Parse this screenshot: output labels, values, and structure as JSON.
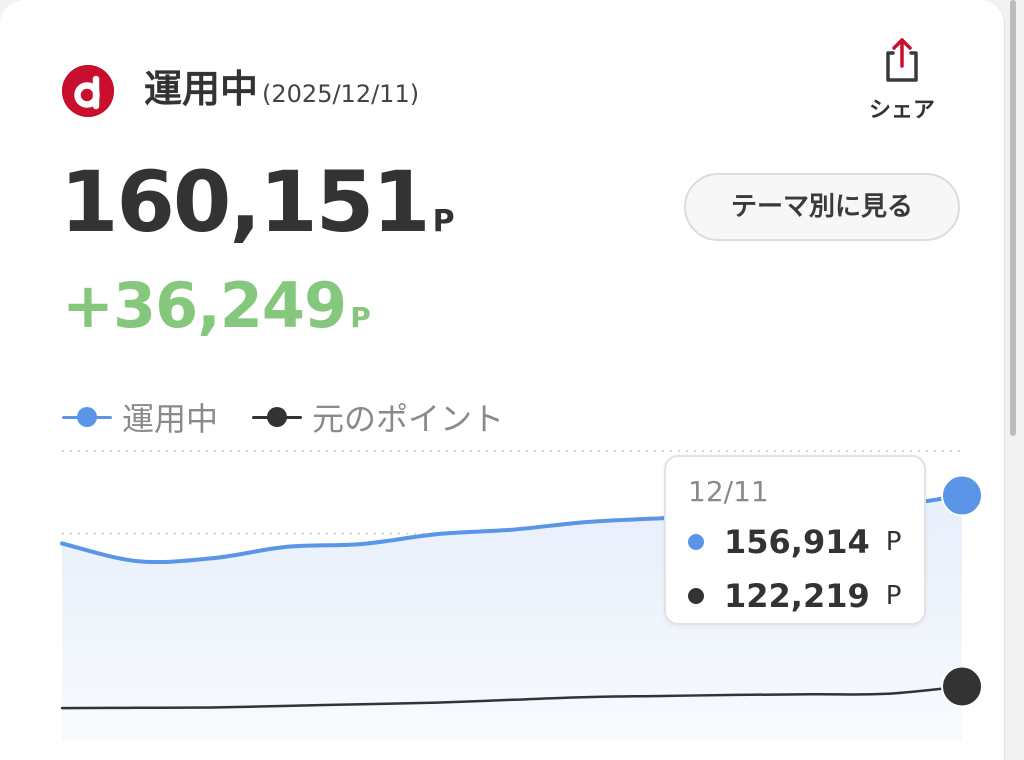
{
  "colors": {
    "brand_red": "#c8102e",
    "series_operating": "#5b95e8",
    "series_principal": "#333333",
    "gain_green": "#86c77e",
    "muted_text": "#8a8a8a"
  },
  "header": {
    "logo_icon": "d-point-logo-icon",
    "title": "運用中",
    "date": "(2025/12/11)",
    "share": {
      "icon": "share-upload-icon",
      "label": "シェア"
    }
  },
  "summary": {
    "balance": "160,151",
    "balance_unit": "P",
    "gain": "+36,249",
    "gain_unit": "P",
    "theme_button": "テーマ別に見る"
  },
  "legend": [
    {
      "label": "運用中",
      "color": "#5b95e8"
    },
    {
      "label": "元のポイント",
      "color": "#333333"
    }
  ],
  "chart_data": {
    "type": "line",
    "series": [
      {
        "name": "運用中",
        "color": "#5b95e8",
        "values": [
          148200,
          145000,
          145500,
          147600,
          148100,
          149900,
          150700,
          152100,
          152800,
          153400,
          154100,
          154900,
          156914
        ]
      },
      {
        "name": "元のポイント",
        "color": "#333333",
        "values": [
          118300,
          118350,
          118400,
          118700,
          119000,
          119300,
          119800,
          120300,
          120500,
          120700,
          120800,
          120900,
          122219
        ]
      }
    ],
    "ylim": [
      112500,
      167000
    ],
    "grid": true,
    "area_fill": "運用中",
    "tooltip": {
      "date": "12/11",
      "rows": [
        {
          "value": "156,914",
          "unit": "P",
          "color": "#5b95e8"
        },
        {
          "value": "122,219",
          "unit": "P",
          "color": "#333333"
        }
      ]
    }
  }
}
